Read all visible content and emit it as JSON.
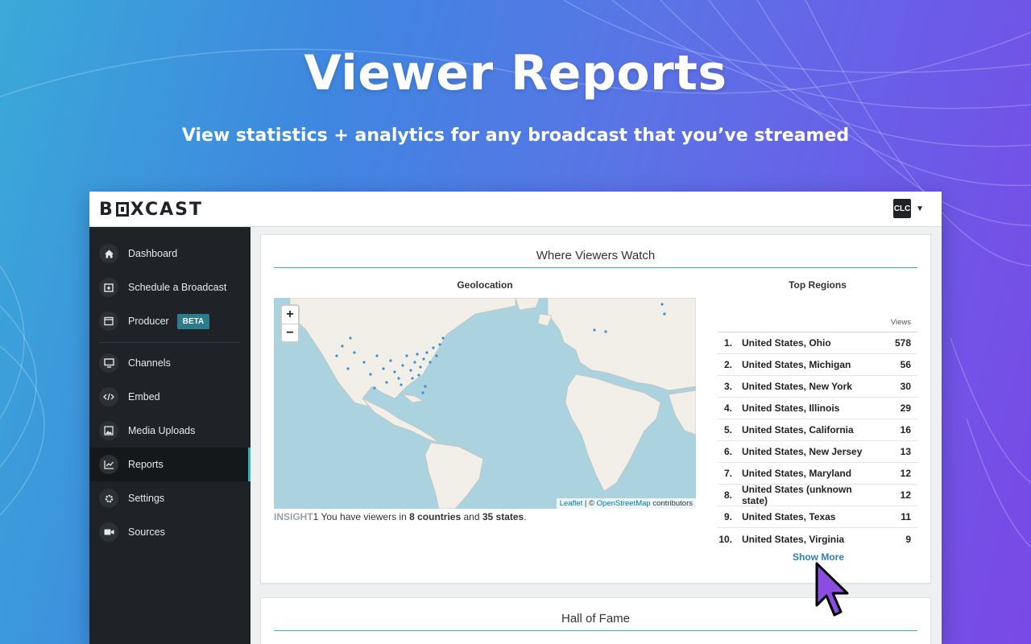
{
  "hero": {
    "title": "Viewer Reports",
    "subtitle": "View statistics + analytics for any broadcast that you’ve streamed"
  },
  "app": {
    "logo": {
      "pre": "B",
      "post": "XCAST"
    },
    "account_badge": "CLC",
    "sidebar": {
      "items": [
        {
          "label": "Dashboard",
          "icon": "home-icon"
        },
        {
          "label": "Schedule a Broadcast",
          "icon": "calendar-plus-icon"
        },
        {
          "label": "Producer",
          "icon": "producer-icon",
          "badge": "BETA"
        },
        {
          "label": "Channels",
          "icon": "monitor-icon"
        },
        {
          "label": "Embed",
          "icon": "code-icon"
        },
        {
          "label": "Media Uploads",
          "icon": "image-icon"
        },
        {
          "label": "Reports",
          "icon": "chart-line-icon",
          "active": true
        },
        {
          "label": "Settings",
          "icon": "gear-icon"
        },
        {
          "label": "Sources",
          "icon": "video-camera-icon"
        }
      ]
    },
    "where_card": {
      "title": "Where Viewers Watch",
      "geo_title": "Geolocation",
      "map": {
        "zoom_in": "+",
        "zoom_out": "−",
        "attribution_leaflet": "Leaflet",
        "attribution_sep": " | © ",
        "attribution_osm": "OpenStreetMap",
        "attribution_tail": " contributors"
      },
      "insight": {
        "label": "INSIGHT",
        "number": "1",
        "text_a": " You have viewers in ",
        "countries": "8 countries",
        "text_b": " and ",
        "states": "35 states",
        "text_c": "."
      },
      "top_regions": {
        "title": "Top Regions",
        "views_header": "Views",
        "rows": [
          {
            "rank": "1.",
            "name": "United States, Ohio",
            "views": "578"
          },
          {
            "rank": "2.",
            "name": "United States, Michigan",
            "views": "56"
          },
          {
            "rank": "3.",
            "name": "United States, New York",
            "views": "30"
          },
          {
            "rank": "4.",
            "name": "United States, Illinois",
            "views": "29"
          },
          {
            "rank": "5.",
            "name": "United States, California",
            "views": "16"
          },
          {
            "rank": "6.",
            "name": "United States, New Jersey",
            "views": "13"
          },
          {
            "rank": "7.",
            "name": "United States, Maryland",
            "views": "12"
          },
          {
            "rank": "8.",
            "name": "United States (unknown state)",
            "views": "12"
          },
          {
            "rank": "9.",
            "name": "United States, Texas",
            "views": "11"
          },
          {
            "rank": "10.",
            "name": "United States, Virginia",
            "views": "9"
          }
        ],
        "show_more": "Show More"
      }
    },
    "hall_card": {
      "title": "Hall of Fame"
    },
    "colors": {
      "accent": "#4aa3d5",
      "sidebar_bg": "#1f2327",
      "active_marker": "#2fb3b5",
      "beta_bg": "#2d7a8b",
      "map_water": "#aad3df",
      "map_dot": "#3a8fd6",
      "cursor_fill": "#8a4de0"
    }
  }
}
